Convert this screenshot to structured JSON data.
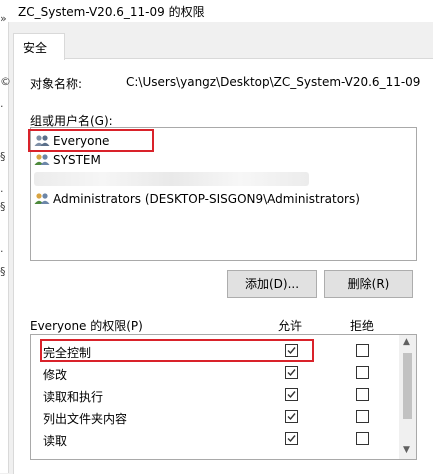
{
  "window": {
    "title": "ZC_System-V20.6_11-09 的权限"
  },
  "left_edge": {
    "chars": [
      "»",
      "©",
      "·",
      "§",
      "·",
      "§",
      "·",
      "§"
    ]
  },
  "tabs": [
    {
      "label": "安全"
    }
  ],
  "object": {
    "label": "对象名称:",
    "value": "C:\\Users\\yangz\\Desktop\\ZC_System-V20.6_11-09"
  },
  "groups": {
    "label": "组或用户名(G):",
    "items": [
      {
        "label": "Everyone",
        "icon": "users-icon"
      },
      {
        "label": "SYSTEM",
        "icon": "users-icon"
      },
      {
        "label": "",
        "icon": ""
      },
      {
        "label": "Administrators (DESKTOP-SISGON9\\Administrators)",
        "icon": "users-icon"
      }
    ]
  },
  "buttons": {
    "add": "添加(D)...",
    "remove": "删除(R)"
  },
  "permissions": {
    "header": "Everyone 的权限(P)",
    "allow_label": "允许",
    "deny_label": "拒绝",
    "rows": [
      {
        "name": "完全控制",
        "allow": true,
        "deny": false
      },
      {
        "name": "修改",
        "allow": true,
        "deny": false
      },
      {
        "name": "读取和执行",
        "allow": true,
        "deny": false
      },
      {
        "name": "列出文件夹内容",
        "allow": true,
        "deny": false
      },
      {
        "name": "读取",
        "allow": true,
        "deny": false
      }
    ]
  },
  "colors": {
    "highlight": "#d9222a",
    "accent": "#0078d7"
  }
}
